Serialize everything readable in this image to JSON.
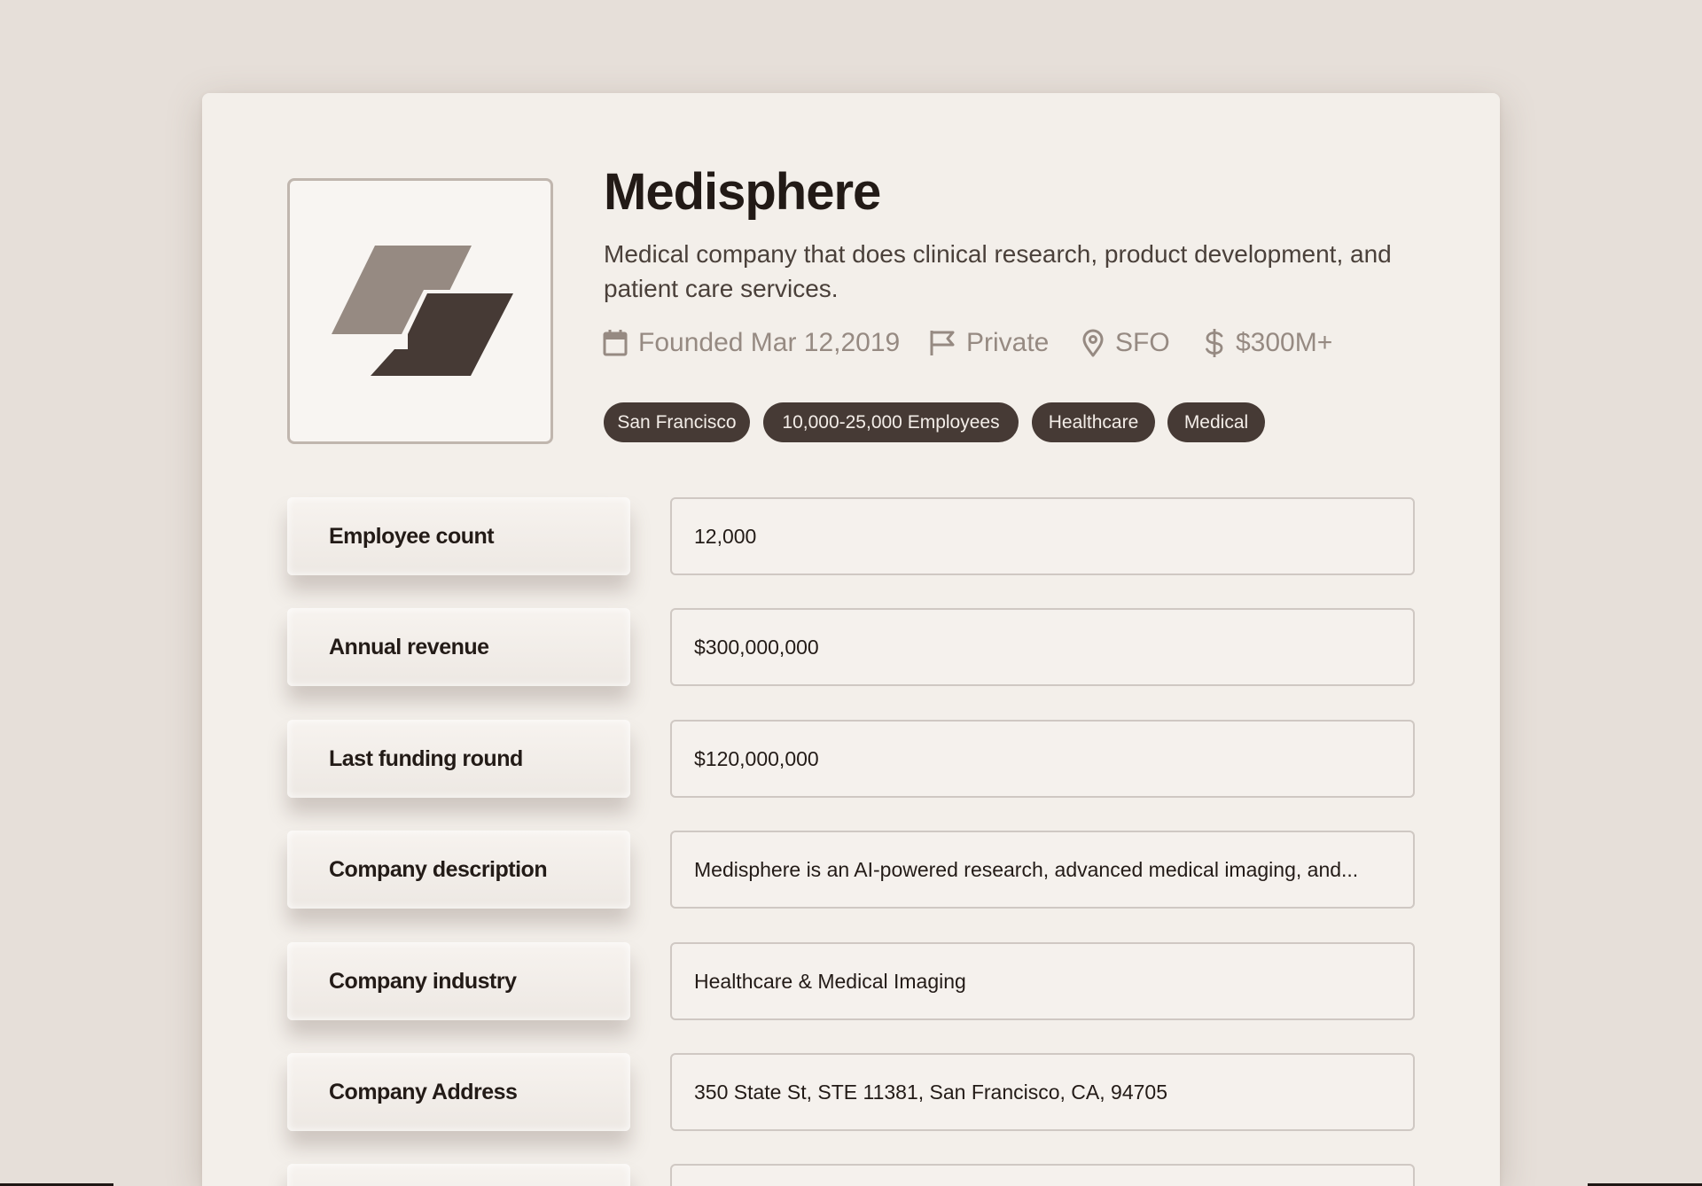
{
  "company": {
    "name": "Medisphere",
    "description": "Medical company that does clinical research, product development, and patient care services.",
    "logo_icon": "medisphere-logo",
    "meta": {
      "founded": "Founded Mar 12,2019",
      "founded_icon": "calendar-icon",
      "type": "Private",
      "type_icon": "flag-icon",
      "location": "SFO",
      "location_icon": "location-pin-icon",
      "funding": "$300M+",
      "funding_icon": "dollar-icon"
    },
    "tags": [
      "San Francisco",
      "10,000-25,000 Employees",
      "Healthcare",
      "Medical"
    ]
  },
  "fields": [
    {
      "label": "Employee count",
      "value": "12,000"
    },
    {
      "label": "Annual revenue",
      "value": "$300,000,000"
    },
    {
      "label": "Last funding round",
      "value": "$120,000,000"
    },
    {
      "label": "Company description",
      "value": "Medisphere is an AI-powered research, advanced medical imaging, and..."
    },
    {
      "label": "Company industry",
      "value": "Healthcare & Medical Imaging"
    },
    {
      "label": "Company Address",
      "value": "350 State St, STE 11381, San Francisco, CA, 94705"
    },
    {
      "label": "",
      "value": ""
    }
  ],
  "colors": {
    "background": "#e6dfd9",
    "card": "#f3efea",
    "tag": "#463a35",
    "logo_light": "#968a82",
    "logo_dark": "#463a35",
    "meta_text": "#968a82"
  }
}
